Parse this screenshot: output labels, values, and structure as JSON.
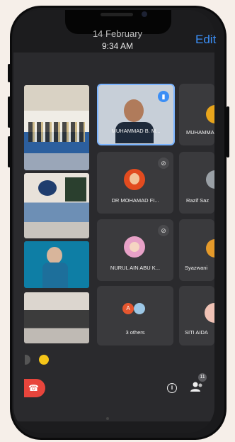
{
  "status": {
    "date": "14 February",
    "time": "9:34 AM"
  },
  "header": {
    "edit_label": "Edit"
  },
  "participants": [
    {
      "name": "MUHAMMAD B. M...",
      "speaking": true
    },
    {
      "name": "MUHAMMA"
    },
    {
      "name": "DR MOHAMAD FI...",
      "muted": true
    },
    {
      "name": "Razif Saz"
    },
    {
      "name": "NURUL AIN ABU K...",
      "muted": true
    },
    {
      "name": "Syazwani"
    },
    {
      "name": "3 others",
      "avatar_letter": "A"
    },
    {
      "name": "SITI AIDA"
    }
  ],
  "controls": {
    "participants_count": "11",
    "info_icon": "info-icon",
    "people_icon": "people-icon",
    "end_call_icon": "end-call-icon"
  },
  "colors": {
    "accent": "#3b8ef5",
    "end_call": "#e8453c",
    "speaking": "#7bb4ff",
    "yellow": "#f5c518"
  }
}
